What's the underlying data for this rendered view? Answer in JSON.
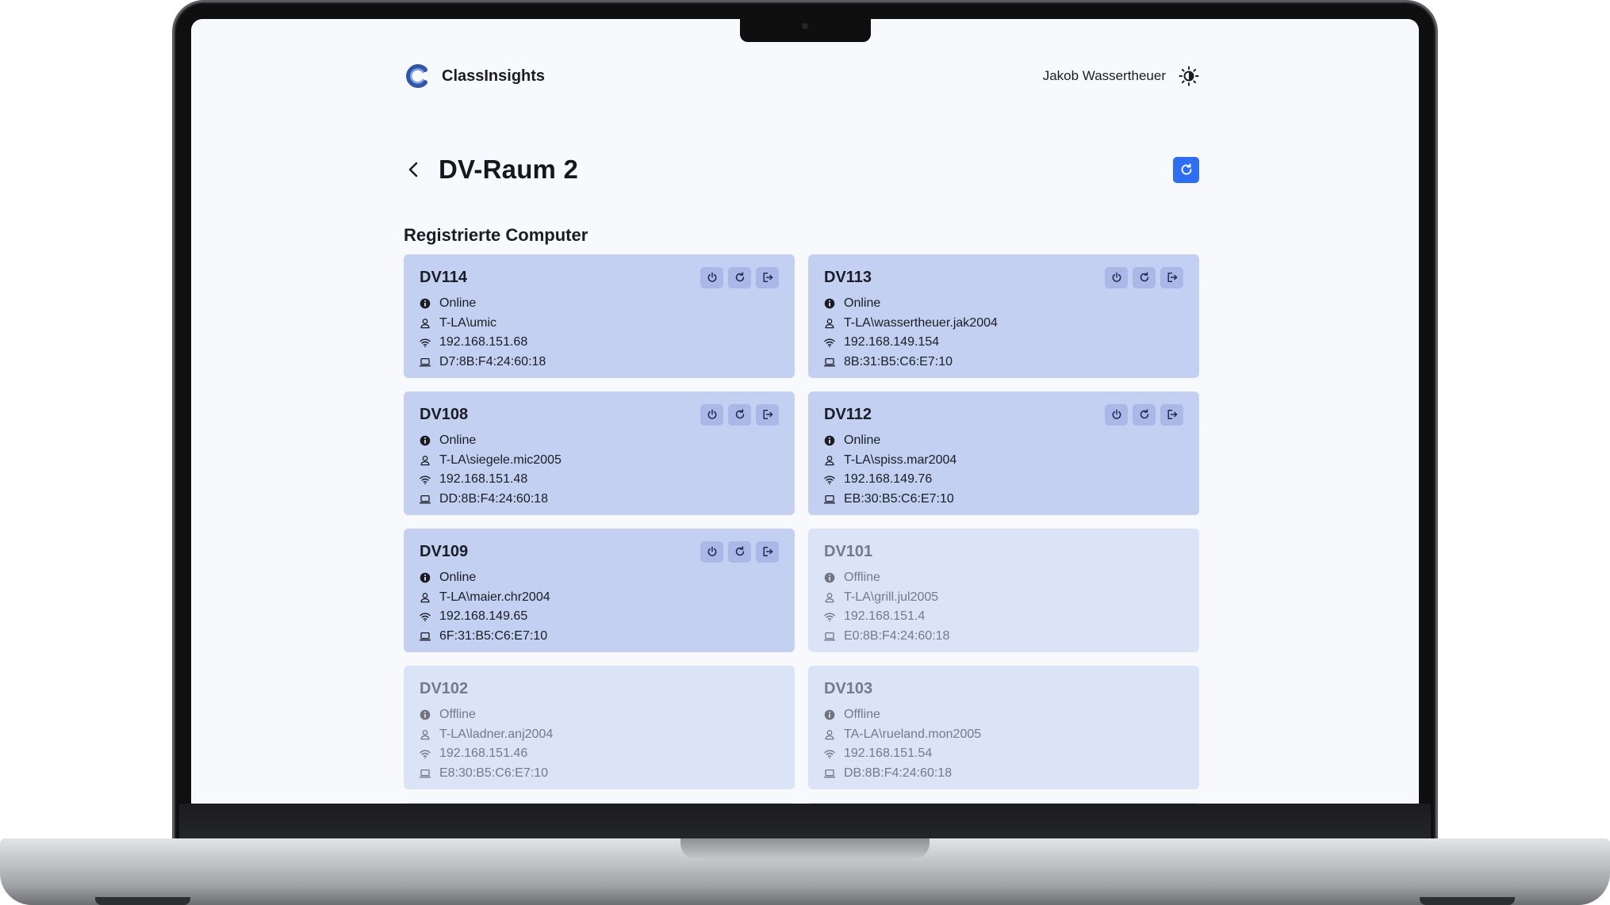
{
  "app": {
    "name": "ClassInsights",
    "user_name": "Jakob Wassertheuer",
    "accent_color": "#2f6ef0"
  },
  "page": {
    "title": "DV-Raum 2",
    "section_title": "Registrierte Computer"
  },
  "icons": {
    "status": "info-circle-icon",
    "user": "user-icon",
    "ip": "wifi-icon",
    "mac": "laptop-icon",
    "actions": [
      "power-icon",
      "restart-icon",
      "logout-icon"
    ]
  },
  "computers": [
    {
      "name": "DV114",
      "status": "Online",
      "user": "T-LA\\umic",
      "ip": "192.168.151.68",
      "mac": "D7:8B:F4:24:60:18"
    },
    {
      "name": "DV113",
      "status": "Online",
      "user": "T-LA\\wassertheuer.jak2004",
      "ip": "192.168.149.154",
      "mac": "8B:31:B5:C6:E7:10"
    },
    {
      "name": "DV108",
      "status": "Online",
      "user": "T-LA\\siegele.mic2005",
      "ip": "192.168.151.48",
      "mac": "DD:8B:F4:24:60:18"
    },
    {
      "name": "DV112",
      "status": "Online",
      "user": "T-LA\\spiss.mar2004",
      "ip": "192.168.149.76",
      "mac": "EB:30:B5:C6:E7:10"
    },
    {
      "name": "DV109",
      "status": "Online",
      "user": "T-LA\\maier.chr2004",
      "ip": "192.168.149.65",
      "mac": "6F:31:B5:C6:E7:10"
    },
    {
      "name": "DV101",
      "status": "Offline",
      "user": "T-LA\\grill.jul2005",
      "ip": "192.168.151.4",
      "mac": "E0:8B:F4:24:60:18"
    },
    {
      "name": "DV102",
      "status": "Offline",
      "user": "T-LA\\ladner.anj2004",
      "ip": "192.168.151.46",
      "mac": "E8:30:B5:C6:E7:10"
    },
    {
      "name": "DV103",
      "status": "Offline",
      "user": "TA-LA\\rueland.mon2005",
      "ip": "192.168.151.54",
      "mac": "DB:8B:F4:24:60:18"
    }
  ]
}
